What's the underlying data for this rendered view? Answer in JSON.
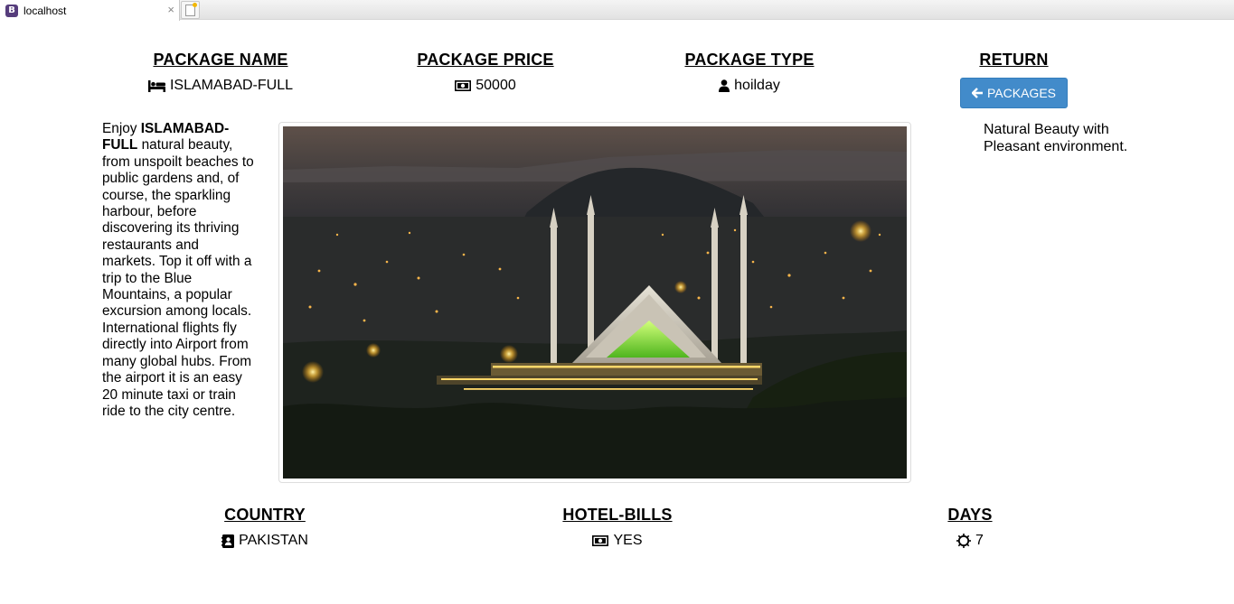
{
  "browser": {
    "tab_title": "localhost",
    "favicon_letter": "B",
    "close_glyph": "×"
  },
  "header": {
    "package_name": {
      "title": "PACKAGE NAME",
      "value": "ISLAMABAD-FULL",
      "icon": "bed-icon"
    },
    "package_price": {
      "title": "PACKAGE PRICE",
      "value": "50000",
      "icon": "money-icon"
    },
    "package_type": {
      "title": "PACKAGE TYPE",
      "value": "hoilday",
      "icon": "user-icon"
    },
    "return": {
      "title": "RETURN",
      "button_label": "PACKAGES",
      "icon": "arrow-left-icon"
    }
  },
  "description": {
    "intro": "Enjoy ",
    "highlight": "ISLAMABAD-FULL",
    "body": " natural beauty, from unspoilt beaches to public gardens and, of course, the sparkling harbour, before discovering its thriving restaurants and markets. Top it off with a trip to the Blue Mountains, a popular excursion among locals. International flights fly directly into Airport from many global hubs. From the airport it is an easy 20 minute taxi or train ride to the city centre."
  },
  "side_note": "Natural Beauty with Pleasant environment.",
  "footer": {
    "country": {
      "title": "COUNTRY",
      "value": "PAKISTAN",
      "icon": "contact-book-icon"
    },
    "hotel_bills": {
      "title": "HOTEL-BILLS",
      "value": "YES",
      "icon": "money-icon"
    },
    "days": {
      "title": "DAYS",
      "value": "7",
      "icon": "sun-icon"
    }
  },
  "colors": {
    "button_bg": "#428bca",
    "mosque_glow": "#7fdc3a"
  }
}
